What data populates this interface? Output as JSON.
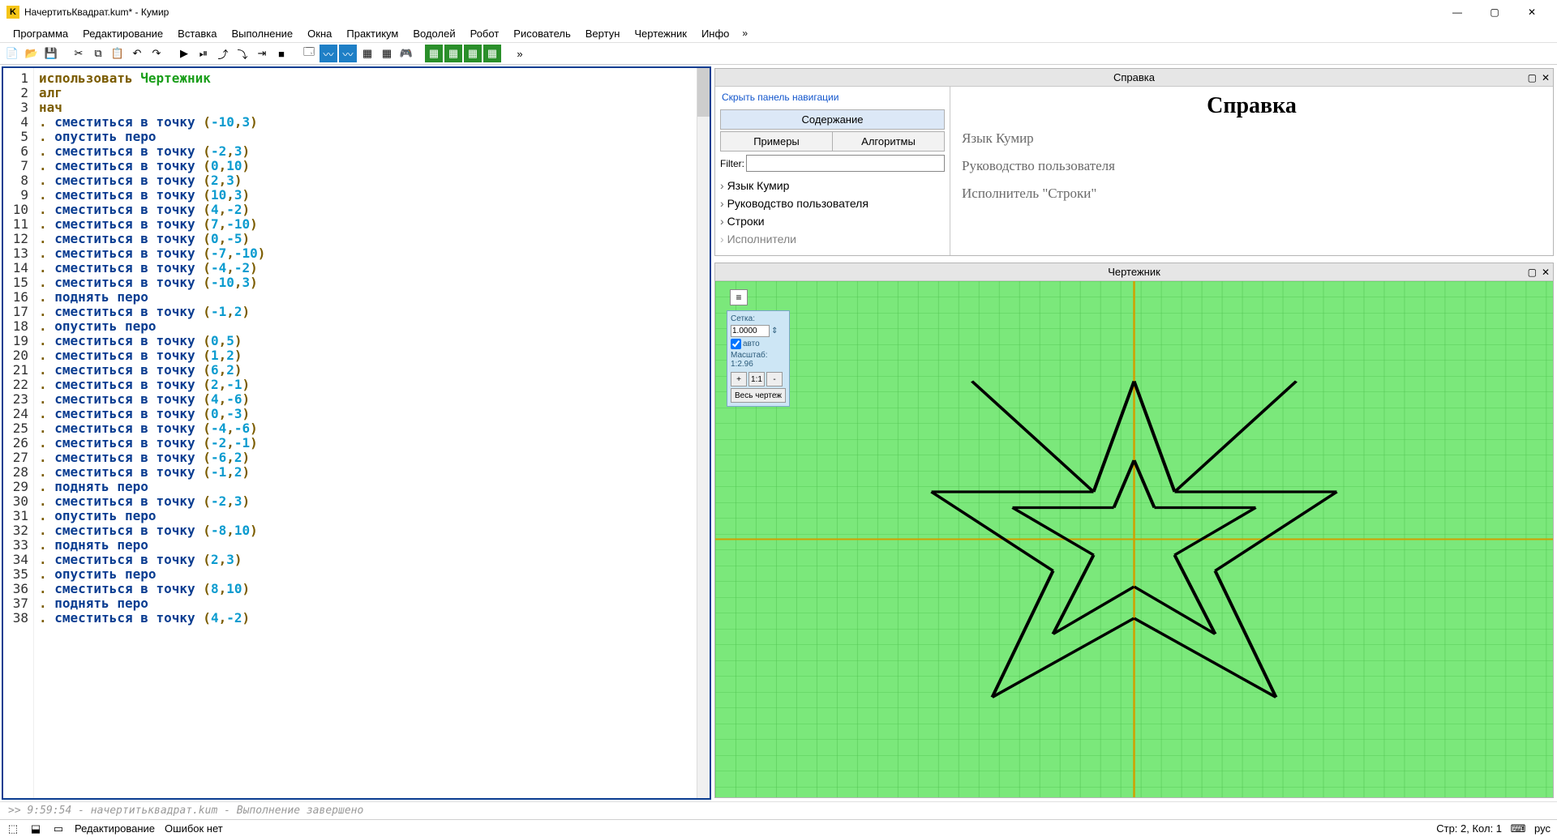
{
  "window": {
    "title": "НачертитьКвадрат.kum* - Кумир",
    "app_icon_letter": "K"
  },
  "win_controls": {
    "min": "—",
    "max": "▢",
    "close": "✕"
  },
  "menu": {
    "items": [
      "Программа",
      "Редактирование",
      "Вставка",
      "Выполнение",
      "Окна",
      "Практикум",
      "Водолей",
      "Робот",
      "Рисователь",
      "Вертун",
      "Чертежник",
      "Инфо"
    ],
    "overflow": "»"
  },
  "code": {
    "lines": [
      {
        "n": 1,
        "t": "kw",
        "pre": "",
        "text": "использовать ",
        "ident": "Чертежник"
      },
      {
        "n": 2,
        "t": "kw",
        "pre": "",
        "text": "алг"
      },
      {
        "n": 3,
        "t": "kw",
        "pre": "",
        "text": "нач"
      },
      {
        "n": 4,
        "t": "move",
        "cmd": "сместиться в точку",
        "a": "-10",
        "b": "3"
      },
      {
        "n": 5,
        "t": "pen",
        "cmd": "опустить перо"
      },
      {
        "n": 6,
        "t": "move",
        "cmd": "сместиться в точку",
        "a": "-2",
        "b": "3"
      },
      {
        "n": 7,
        "t": "move",
        "cmd": "сместиться в точку",
        "a": "0",
        "b": "10"
      },
      {
        "n": 8,
        "t": "move",
        "cmd": "сместиться в точку",
        "a": "2",
        "b": "3"
      },
      {
        "n": 9,
        "t": "move",
        "cmd": "сместиться в точку",
        "a": "10",
        "b": "3"
      },
      {
        "n": 10,
        "t": "move",
        "cmd": "сместиться в точку",
        "a": "4",
        "b": "-2"
      },
      {
        "n": 11,
        "t": "move",
        "cmd": "сместиться в точку",
        "a": "7",
        "b": "-10"
      },
      {
        "n": 12,
        "t": "move",
        "cmd": "сместиться в точку",
        "a": "0",
        "b": "-5"
      },
      {
        "n": 13,
        "t": "move",
        "cmd": "сместиться в точку",
        "a": "-7",
        "b": "-10"
      },
      {
        "n": 14,
        "t": "move",
        "cmd": "сместиться в точку",
        "a": "-4",
        "b": "-2"
      },
      {
        "n": 15,
        "t": "move",
        "cmd": "сместиться в точку",
        "a": "-10",
        "b": "3"
      },
      {
        "n": 16,
        "t": "pen",
        "cmd": "поднять перо"
      },
      {
        "n": 17,
        "t": "move",
        "cmd": "сместиться в точку",
        "a": "-1",
        "b": "2"
      },
      {
        "n": 18,
        "t": "pen",
        "cmd": "опустить перо"
      },
      {
        "n": 19,
        "t": "move",
        "cmd": "сместиться в точку",
        "a": "0",
        "b": "5"
      },
      {
        "n": 20,
        "t": "move",
        "cmd": "сместиться в точку",
        "a": "1",
        "b": "2"
      },
      {
        "n": 21,
        "t": "move",
        "cmd": "сместиться в точку",
        "a": "6",
        "b": "2"
      },
      {
        "n": 22,
        "t": "move",
        "cmd": "сместиться в точку",
        "a": "2",
        "b": "-1"
      },
      {
        "n": 23,
        "t": "move",
        "cmd": "сместиться в точку",
        "a": "4",
        "b": "-6"
      },
      {
        "n": 24,
        "t": "move",
        "cmd": "сместиться в точку",
        "a": "0",
        "b": "-3"
      },
      {
        "n": 25,
        "t": "move",
        "cmd": "сместиться в точку",
        "a": "-4",
        "b": "-6"
      },
      {
        "n": 26,
        "t": "move",
        "cmd": "сместиться в точку",
        "a": "-2",
        "b": "-1"
      },
      {
        "n": 27,
        "t": "move",
        "cmd": "сместиться в точку",
        "a": "-6",
        "b": "2"
      },
      {
        "n": 28,
        "t": "move",
        "cmd": "сместиться в точку",
        "a": "-1",
        "b": "2"
      },
      {
        "n": 29,
        "t": "pen",
        "cmd": "поднять перо"
      },
      {
        "n": 30,
        "t": "move",
        "cmd": "сместиться в точку",
        "a": "-2",
        "b": "3"
      },
      {
        "n": 31,
        "t": "pen",
        "cmd": "опустить перо"
      },
      {
        "n": 32,
        "t": "move",
        "cmd": "сместиться в точку",
        "a": "-8",
        "b": "10"
      },
      {
        "n": 33,
        "t": "pen",
        "cmd": "поднять перо"
      },
      {
        "n": 34,
        "t": "move",
        "cmd": "сместиться в точку",
        "a": "2",
        "b": "3"
      },
      {
        "n": 35,
        "t": "pen",
        "cmd": "опустить перо"
      },
      {
        "n": 36,
        "t": "move",
        "cmd": "сместиться в точку",
        "a": "8",
        "b": "10"
      },
      {
        "n": 37,
        "t": "pen",
        "cmd": "поднять перо"
      },
      {
        "n": 38,
        "t": "move",
        "cmd": "сместиться в точку",
        "a": "4",
        "b": "-2"
      }
    ]
  },
  "help": {
    "panel_title": "Справка",
    "hide_nav": "Скрыть панель навигации",
    "tabs": {
      "contents": "Содержание",
      "examples": "Примеры",
      "algorithms": "Алгоритмы"
    },
    "filter_label": "Filter:",
    "tree": [
      "Язык Кумир",
      "Руководство пользователя",
      "Строки",
      "Исполнители"
    ],
    "heading": "Справка",
    "links": [
      "Язык Кумир",
      "Руководство пользователя",
      "Исполнитель \"Строки\""
    ]
  },
  "drawer": {
    "panel_title": "Чертежник",
    "grid_label": "Сетка:",
    "grid_value": "1.0000",
    "auto_label": "авто",
    "scale_label": "Масштаб:",
    "scale_value": "1:2.96",
    "btn_plus": "+",
    "btn_11": "1:1",
    "btn_minus": "-",
    "btn_all": "Весь чертеж"
  },
  "console": {
    "text": ">>  9:59:54 - начертитьквадрат.kum - Выполнение завершено"
  },
  "status": {
    "mode": "Редактирование",
    "errors": "Ошибок нет",
    "position": "Стр: 2, Кол: 1",
    "lang": "рус"
  }
}
